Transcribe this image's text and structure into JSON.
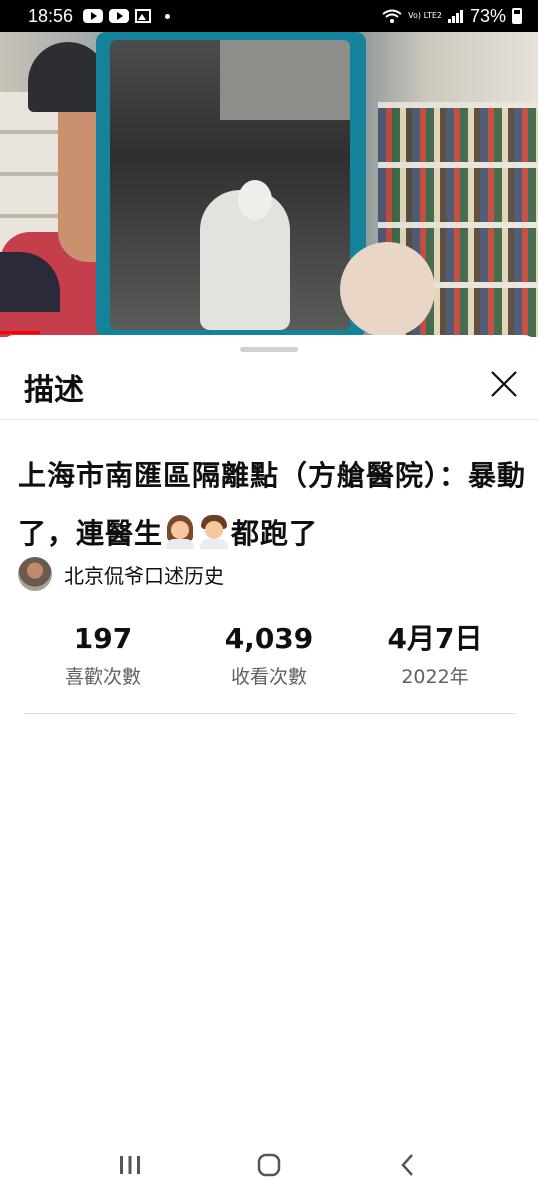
{
  "status_bar": {
    "time": "18:56",
    "network": "Vo) LTE2",
    "battery": "73%"
  },
  "sheet": {
    "title": "描述",
    "video_title_part1": "上海市南匯區隔離點（方艙醫院）：暴動了，連醫生",
    "video_title_part2": "都跑了",
    "channel_name": "北京侃爷口述历史",
    "stats": [
      {
        "value": "197",
        "label": "喜歡次數"
      },
      {
        "value": "4,039",
        "label": "收看次數"
      },
      {
        "value": "4月7日",
        "label": "2022年"
      }
    ]
  },
  "icons": {
    "status": [
      "youtube-icon",
      "youtube-icon",
      "gallery-icon",
      "dot-icon",
      "wifi-icon",
      "signal-icon",
      "battery-icon"
    ],
    "emoji": [
      "woman-health-worker-emoji",
      "man-health-worker-emoji"
    ],
    "nav": [
      "recent-apps-icon",
      "home-icon",
      "back-icon"
    ]
  },
  "colors": {
    "progress": "#ff0000",
    "secondary_text": "#606060"
  }
}
